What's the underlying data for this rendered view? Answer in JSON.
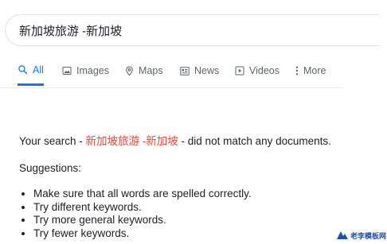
{
  "search": {
    "query": "新加坡旅游 -新加坡"
  },
  "tabs": [
    {
      "label": "All",
      "icon": "search-icon",
      "active": true
    },
    {
      "label": "Images",
      "icon": "image-icon",
      "active": false
    },
    {
      "label": "Maps",
      "icon": "map-pin-icon",
      "active": false
    },
    {
      "label": "News",
      "icon": "news-icon",
      "active": false
    },
    {
      "label": "Videos",
      "icon": "play-icon",
      "active": false
    },
    {
      "label": "More",
      "icon": "kebab-icon",
      "active": false
    }
  ],
  "results": {
    "prefix": "Your search - ",
    "query": "新加坡旅游 -新加坡",
    "suffix": " - did not match any documents.",
    "suggestions_title": "Suggestions:",
    "suggestions": [
      "Make sure that all words are spelled correctly.",
      "Try different keywords.",
      "Try more general keywords.",
      "Try fewer keywords."
    ]
  },
  "watermark": {
    "text": "老李模板网"
  },
  "colors": {
    "accent": "#1a73e8",
    "query_red": "#dd4b39",
    "tab_grey": "#5f6368"
  }
}
